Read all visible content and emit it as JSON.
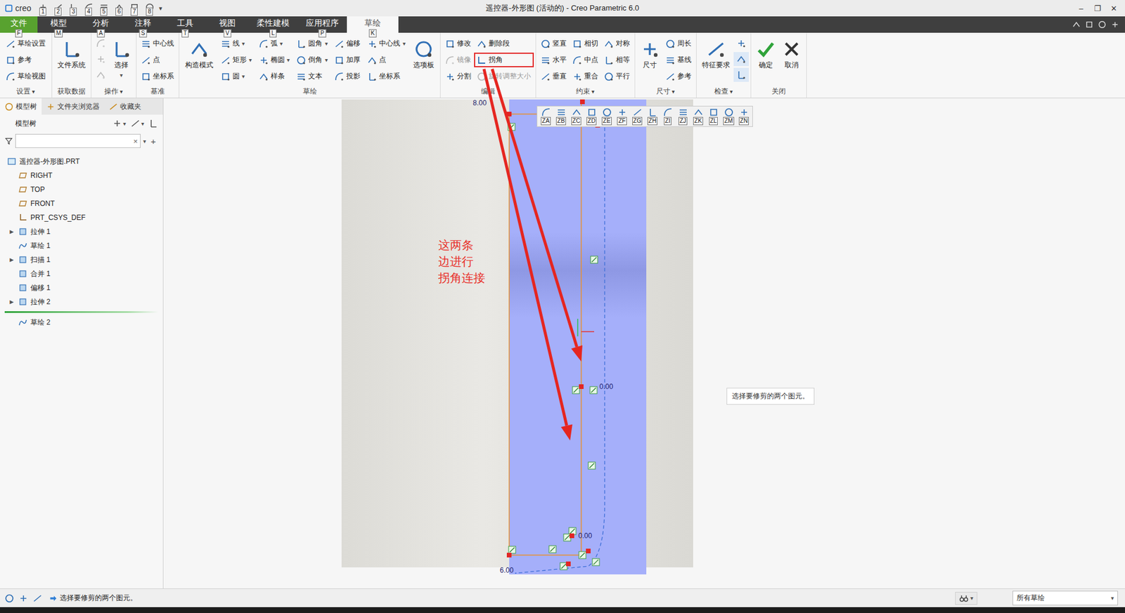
{
  "window": {
    "title": "遥控器-外形图 (活动的) - Creo Parametric 6.0",
    "app": "creo",
    "controls": [
      "–",
      "❐",
      "✕"
    ]
  },
  "quick_access": {
    "keytips": [
      "1",
      "2",
      "3",
      "4",
      "5",
      "6",
      "7",
      "8"
    ],
    "more": "▾"
  },
  "menu_tabs": [
    {
      "label": "文件",
      "keytip": "F",
      "selected": false,
      "kind": "file"
    },
    {
      "label": "模型",
      "keytip": "M",
      "selected": false,
      "kind": "tab"
    },
    {
      "label": "分析",
      "keytip": "A",
      "selected": false,
      "kind": "tab"
    },
    {
      "label": "注释",
      "keytip": "S",
      "selected": false,
      "kind": "tab"
    },
    {
      "label": "工具",
      "keytip": "T",
      "selected": false,
      "kind": "tab"
    },
    {
      "label": "视图",
      "keytip": "V",
      "selected": false,
      "kind": "tab"
    },
    {
      "label": "柔性建模",
      "keytip": "L",
      "selected": false,
      "kind": "tab"
    },
    {
      "label": "应用程序",
      "keytip": "P",
      "selected": false,
      "kind": "tab"
    },
    {
      "label": "草绘",
      "keytip": "K",
      "selected": true,
      "kind": "tab"
    }
  ],
  "ribbon": {
    "groups": [
      {
        "label": "设置",
        "dropdown": "▾",
        "columns": [
          {
            "kind": "small",
            "items": [
              {
                "label": "草绘设置",
                "caret": "",
                "disabled": false,
                "highlighted": false
              },
              {
                "label": "参考",
                "caret": "",
                "disabled": false,
                "highlighted": false
              },
              {
                "label": "草绘视图",
                "caret": "",
                "disabled": false,
                "highlighted": false
              }
            ]
          }
        ]
      },
      {
        "label": "获取数据",
        "dropdown": "",
        "columns": [
          {
            "kind": "big",
            "items": [
              {
                "label": "文件系统",
                "caret": "",
                "disabled": false,
                "highlighted": false
              }
            ]
          }
        ]
      },
      {
        "label": "操作",
        "dropdown": "▾",
        "columns": [
          {
            "kind": "icon",
            "items": [
              {
                "label": "",
                "caret": "",
                "disabled": true,
                "highlighted": false
              },
              {
                "label": "",
                "caret": "",
                "disabled": true,
                "highlighted": false
              },
              {
                "label": "",
                "caret": "",
                "disabled": true,
                "highlighted": false
              }
            ]
          },
          {
            "kind": "big",
            "items": [
              {
                "label": "选择",
                "caret": "▾",
                "disabled": false,
                "highlighted": false
              }
            ]
          }
        ]
      },
      {
        "label": "基准",
        "dropdown": "",
        "columns": [
          {
            "kind": "small",
            "items": [
              {
                "label": "中心线",
                "caret": "",
                "disabled": false,
                "highlighted": false
              },
              {
                "label": "点",
                "caret": "",
                "disabled": false,
                "highlighted": false
              },
              {
                "label": "坐标系",
                "caret": "",
                "disabled": false,
                "highlighted": false
              }
            ]
          }
        ]
      },
      {
        "label": "草绘",
        "dropdown": "",
        "columns": [
          {
            "kind": "big",
            "items": [
              {
                "label": "构造模式",
                "caret": "",
                "disabled": false,
                "highlighted": false
              }
            ]
          },
          {
            "kind": "small",
            "items": [
              {
                "label": "线",
                "caret": "▾",
                "disabled": false,
                "highlighted": false
              },
              {
                "label": "矩形",
                "caret": "▾",
                "disabled": false,
                "highlighted": false
              },
              {
                "label": "圆",
                "caret": "▾",
                "disabled": false,
                "highlighted": false
              }
            ]
          },
          {
            "kind": "small",
            "items": [
              {
                "label": "弧",
                "caret": "▾",
                "disabled": false,
                "highlighted": false
              },
              {
                "label": "椭圆",
                "caret": "▾",
                "disabled": false,
                "highlighted": false
              },
              {
                "label": "样条",
                "caret": "",
                "disabled": false,
                "highlighted": false
              }
            ]
          },
          {
            "kind": "small",
            "items": [
              {
                "label": "圆角",
                "caret": "▾",
                "disabled": false,
                "highlighted": false
              },
              {
                "label": "倒角",
                "caret": "▾",
                "disabled": false,
                "highlighted": false
              },
              {
                "label": "文本",
                "caret": "",
                "disabled": false,
                "highlighted": false
              }
            ]
          },
          {
            "kind": "small",
            "items": [
              {
                "label": "偏移",
                "caret": "",
                "disabled": false,
                "highlighted": false
              },
              {
                "label": "加厚",
                "caret": "",
                "disabled": false,
                "highlighted": false
              },
              {
                "label": "投影",
                "caret": "",
                "disabled": false,
                "highlighted": false
              }
            ]
          },
          {
            "kind": "small",
            "items": [
              {
                "label": "中心线",
                "caret": "▾",
                "disabled": false,
                "highlighted": false
              },
              {
                "label": "点",
                "caret": "",
                "disabled": false,
                "highlighted": false
              },
              {
                "label": "坐标系",
                "caret": "",
                "disabled": false,
                "highlighted": false
              }
            ]
          },
          {
            "kind": "big",
            "items": [
              {
                "label": "选项板",
                "caret": "",
                "disabled": false,
                "highlighted": false
              }
            ]
          }
        ]
      },
      {
        "label": "编辑",
        "dropdown": "",
        "columns": [
          {
            "kind": "small",
            "items": [
              {
                "label": "修改",
                "caret": "",
                "disabled": false,
                "highlighted": false
              },
              {
                "label": "镜像",
                "caret": "",
                "disabled": true,
                "highlighted": false
              },
              {
                "label": "分割",
                "caret": "",
                "disabled": false,
                "highlighted": false
              }
            ]
          },
          {
            "kind": "small",
            "items": [
              {
                "label": "删除段",
                "caret": "",
                "disabled": false,
                "highlighted": false
              },
              {
                "label": "拐角",
                "caret": "",
                "disabled": false,
                "highlighted": true
              },
              {
                "label": "旋转调整大小",
                "caret": "",
                "disabled": true,
                "highlighted": false
              }
            ]
          }
        ]
      },
      {
        "label": "约束",
        "dropdown": "▾",
        "columns": [
          {
            "kind": "small",
            "items": [
              {
                "label": "竖直",
                "caret": "",
                "disabled": false,
                "highlighted": false
              },
              {
                "label": "水平",
                "caret": "",
                "disabled": false,
                "highlighted": false
              },
              {
                "label": "垂直",
                "caret": "",
                "disabled": false,
                "highlighted": false
              }
            ]
          },
          {
            "kind": "small",
            "items": [
              {
                "label": "相切",
                "caret": "",
                "disabled": false,
                "highlighted": false
              },
              {
                "label": "中点",
                "caret": "",
                "disabled": false,
                "highlighted": false
              },
              {
                "label": "重合",
                "caret": "",
                "disabled": false,
                "highlighted": false
              }
            ]
          },
          {
            "kind": "small",
            "items": [
              {
                "label": "对称",
                "caret": "",
                "disabled": false,
                "highlighted": false
              },
              {
                "label": "相等",
                "caret": "",
                "disabled": false,
                "highlighted": false
              },
              {
                "label": "平行",
                "caret": "",
                "disabled": false,
                "highlighted": false
              }
            ]
          }
        ]
      },
      {
        "label": "尺寸",
        "dropdown": "▾",
        "columns": [
          {
            "kind": "big",
            "items": [
              {
                "label": "尺寸",
                "caret": "",
                "disabled": false,
                "highlighted": false
              }
            ]
          },
          {
            "kind": "small",
            "items": [
              {
                "label": "周长",
                "caret": "",
                "disabled": false,
                "highlighted": false
              },
              {
                "label": "基线",
                "caret": "",
                "disabled": false,
                "highlighted": false
              },
              {
                "label": "参考",
                "caret": "",
                "disabled": false,
                "highlighted": false
              }
            ]
          }
        ]
      },
      {
        "label": "检查",
        "dropdown": "▾",
        "columns": [
          {
            "kind": "big",
            "items": [
              {
                "label": "特征要求",
                "caret": "",
                "disabled": false,
                "highlighted": false
              }
            ]
          },
          {
            "kind": "icon",
            "items": [
              {
                "label": "",
                "caret": "",
                "disabled": false,
                "highlighted": false
              },
              {
                "label": "",
                "caret": "",
                "disabled": false,
                "highlighted": true
              },
              {
                "label": "",
                "caret": "",
                "disabled": false,
                "highlighted": true
              }
            ]
          }
        ]
      },
      {
        "label": "关闭",
        "dropdown": "",
        "columns": [
          {
            "kind": "big",
            "items": [
              {
                "label": "确定",
                "caret": "",
                "disabled": false,
                "highlighted": false
              }
            ]
          },
          {
            "kind": "big",
            "items": [
              {
                "label": "取消",
                "caret": "",
                "disabled": false,
                "highlighted": false
              }
            ]
          }
        ]
      }
    ]
  },
  "side_panel": {
    "tabs": [
      {
        "label": "模型树",
        "selected": true
      },
      {
        "label": "文件夹浏览器",
        "selected": false
      },
      {
        "label": "收藏夹",
        "selected": false
      }
    ],
    "header": "模型树",
    "tools": [
      {
        "caret": "▾"
      },
      {
        "caret": "▾"
      },
      {
        "caret": ""
      }
    ],
    "filter": {
      "placeholder": "",
      "clear": "×",
      "caret": "▾",
      "add": "+"
    },
    "tree": [
      {
        "label": "遥控器-外形图.PRT",
        "level": 0,
        "toggle": "",
        "insert_before": false
      },
      {
        "label": "RIGHT",
        "level": 1,
        "toggle": "",
        "insert_before": false
      },
      {
        "label": "TOP",
        "level": 1,
        "toggle": "",
        "insert_before": false
      },
      {
        "label": "FRONT",
        "level": 1,
        "toggle": "",
        "insert_before": false
      },
      {
        "label": "PRT_CSYS_DEF",
        "level": 1,
        "toggle": "",
        "insert_before": false
      },
      {
        "label": "拉伸 1",
        "level": 1,
        "toggle": "▶",
        "insert_before": false
      },
      {
        "label": "草绘 1",
        "level": 1,
        "toggle": "",
        "insert_before": false
      },
      {
        "label": "扫描 1",
        "level": 1,
        "toggle": "▶",
        "insert_before": false
      },
      {
        "label": "合并 1",
        "level": 1,
        "toggle": "",
        "insert_before": false
      },
      {
        "label": "偏移 1",
        "level": 1,
        "toggle": "",
        "insert_before": false
      },
      {
        "label": "拉伸 2",
        "level": 1,
        "toggle": "▶",
        "insert_before": false
      },
      {
        "label": "草绘 2",
        "level": 1,
        "toggle": "",
        "insert_before": true
      }
    ]
  },
  "graphics": {
    "toolbar": [
      "ZA",
      "ZB",
      "ZC",
      "ZD",
      "ZE",
      "ZF",
      "ZG",
      "ZH",
      "ZI",
      "ZJ",
      "ZK",
      "ZL",
      "ZM",
      "ZN"
    ],
    "dimensions": [
      "8.00",
      "6.00",
      "0.00",
      "0.00"
    ],
    "annotation": [
      "这两条",
      "边进行",
      "拐角连接"
    ],
    "tooltip": "选择要修剪的两个图元。"
  },
  "status_bar": {
    "message": "选择要修剪的两个图元。",
    "filter": "所有草绘",
    "filter_caret": "▾",
    "tool_caret": "▾"
  }
}
